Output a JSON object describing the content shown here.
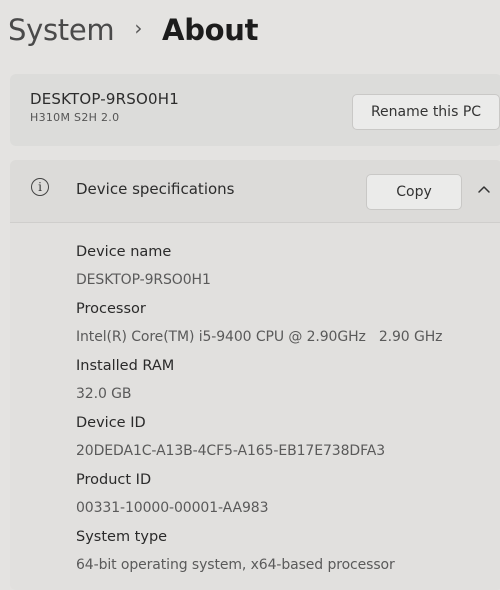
{
  "breadcrumb": {
    "parent": "System",
    "separator": "›",
    "current": "About"
  },
  "pc": {
    "name": "DESKTOP-9RSO0H1",
    "model": "H310M S2H 2.0",
    "rename_label": "Rename this PC"
  },
  "device_specs": {
    "title": "Device specifications",
    "copy_label": "Copy",
    "icon": "info-icon",
    "expanded": true,
    "items": [
      {
        "label": "Device name",
        "value": "DESKTOP-9RSO0H1"
      },
      {
        "label": "Processor",
        "value": "Intel(R) Core(TM) i5-9400 CPU @ 2.90GHz   2.90 GHz"
      },
      {
        "label": "Installed RAM",
        "value": "32.0 GB"
      },
      {
        "label": "Device ID",
        "value": "20DEDA1C-A13B-4CF5-A165-EB17E738DFA3"
      },
      {
        "label": "Product ID",
        "value": "00331-10000-00001-AA983"
      },
      {
        "label": "System type",
        "value": "64-bit operating system, x64-based processor"
      }
    ]
  }
}
